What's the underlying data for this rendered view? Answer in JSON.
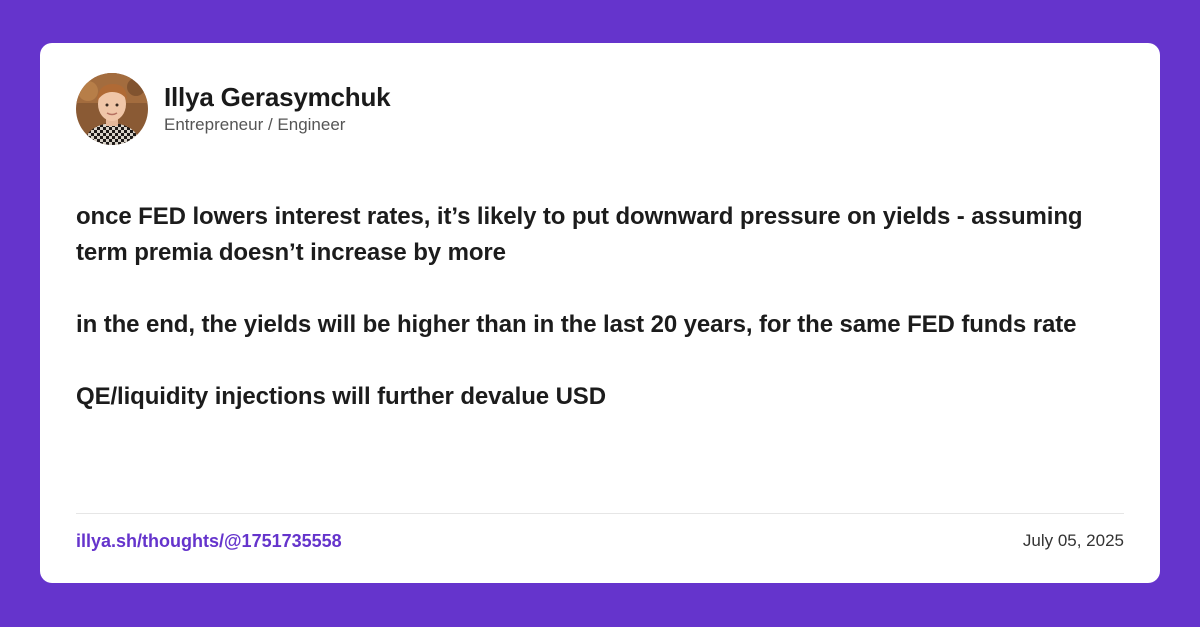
{
  "theme": {
    "background": "#6534cc",
    "card": "#ffffff",
    "accent": "#6534cc"
  },
  "author": {
    "name": "Illya Gerasymchuk",
    "role": "Entrepreneur / Engineer",
    "avatar_icon": "profile-photo"
  },
  "post": {
    "paragraphs": [
      "once FED lowers interest rates, it’s likely to put downward pressure on yields - assuming term premia doesn’t increase by more",
      "in the end, the yields will be higher than in the last 20 years, for the same FED funds rate",
      "QE/liquidity injections will further devalue USD"
    ]
  },
  "footer": {
    "link": "illya.sh/thoughts/@1751735558",
    "date": "July 05, 2025"
  }
}
